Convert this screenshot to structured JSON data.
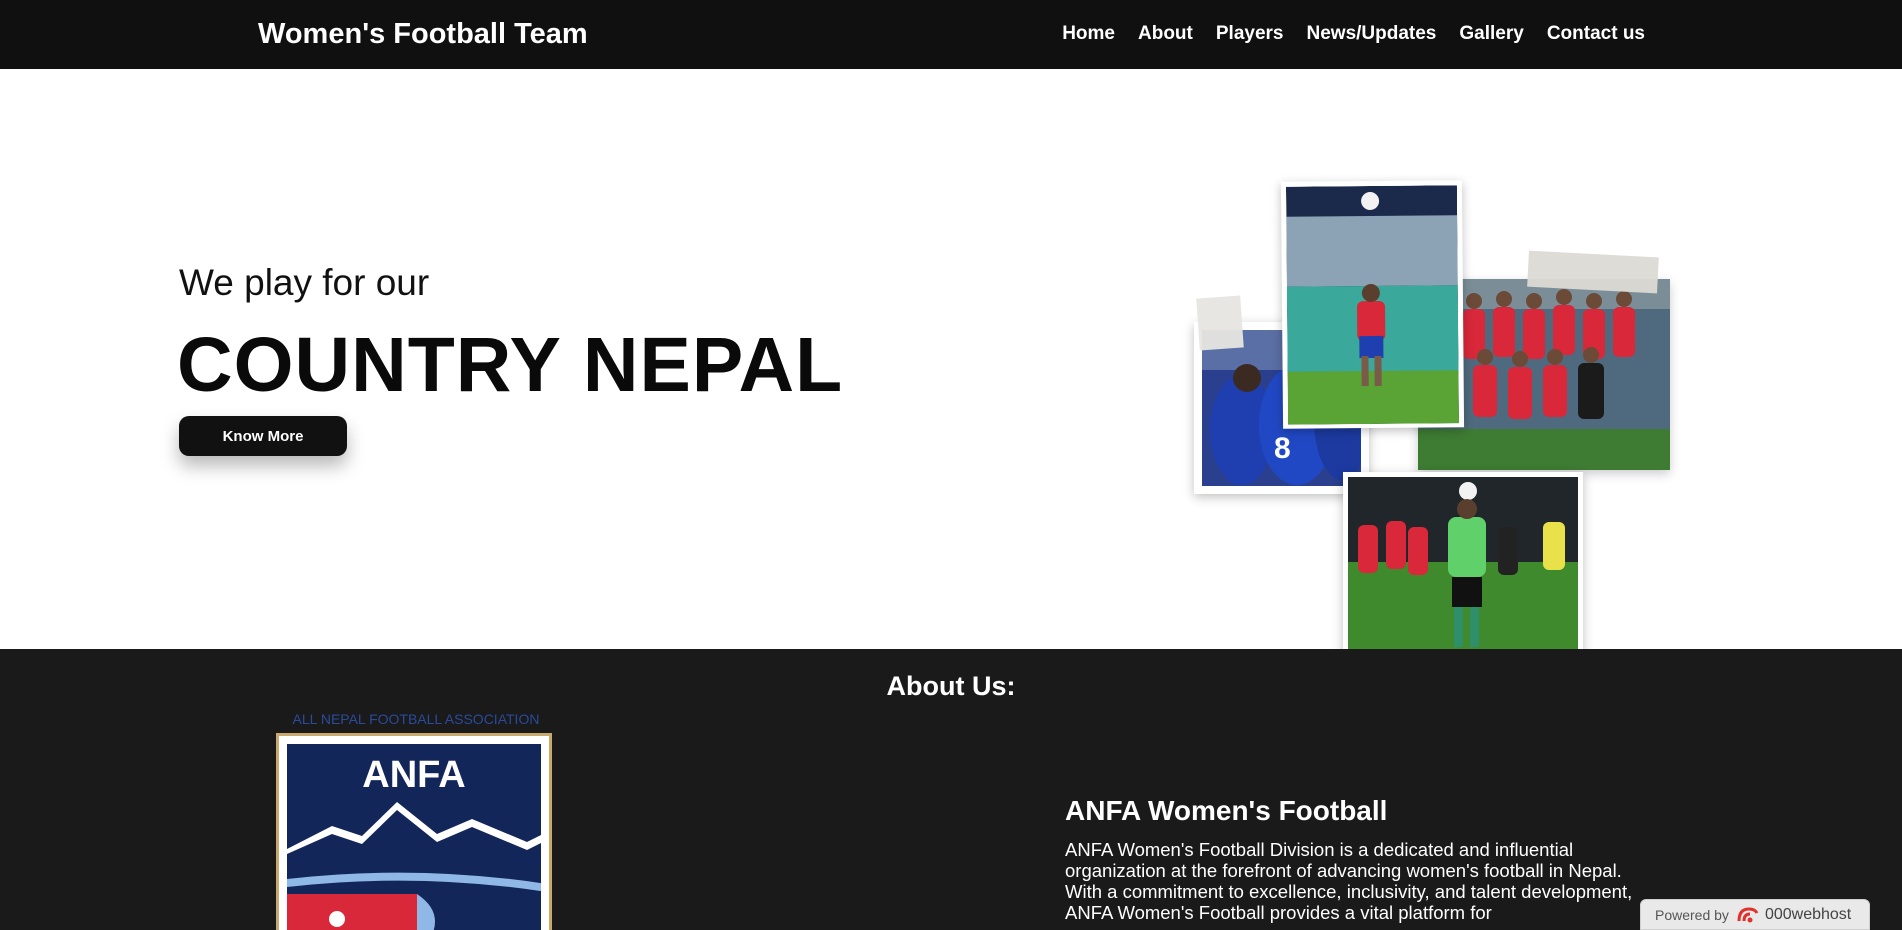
{
  "header": {
    "brand": "Women's Football Team",
    "nav": [
      "Home",
      "About",
      "Players",
      "News/Updates",
      "Gallery",
      "Contact us"
    ]
  },
  "hero": {
    "subtitle": "We play for our",
    "title": "COUNTRY NEPAL",
    "button_label": "Know More"
  },
  "about": {
    "heading": "About Us:",
    "logo_arc_text": "ALL NEPAL FOOTBALL ASSOCIATION",
    "logo_text": "ANFA",
    "title": "ANFA Women's Football",
    "paragraph": "ANFA Women's Football Division is a dedicated and influential organization at the forefront of advancing women's football in Nepal. With a commitment to excellence, inclusivity, and talent development, ANFA Women's Football provides a vital platform for"
  },
  "badge": {
    "powered_by": "Powered by",
    "host": "000webhost"
  },
  "colors": {
    "navbar_bg": "#101010",
    "about_bg": "#1a1a1a",
    "button_bg": "#111111",
    "jersey_red": "#d8283a",
    "jersey_blue": "#1f3fb0"
  }
}
